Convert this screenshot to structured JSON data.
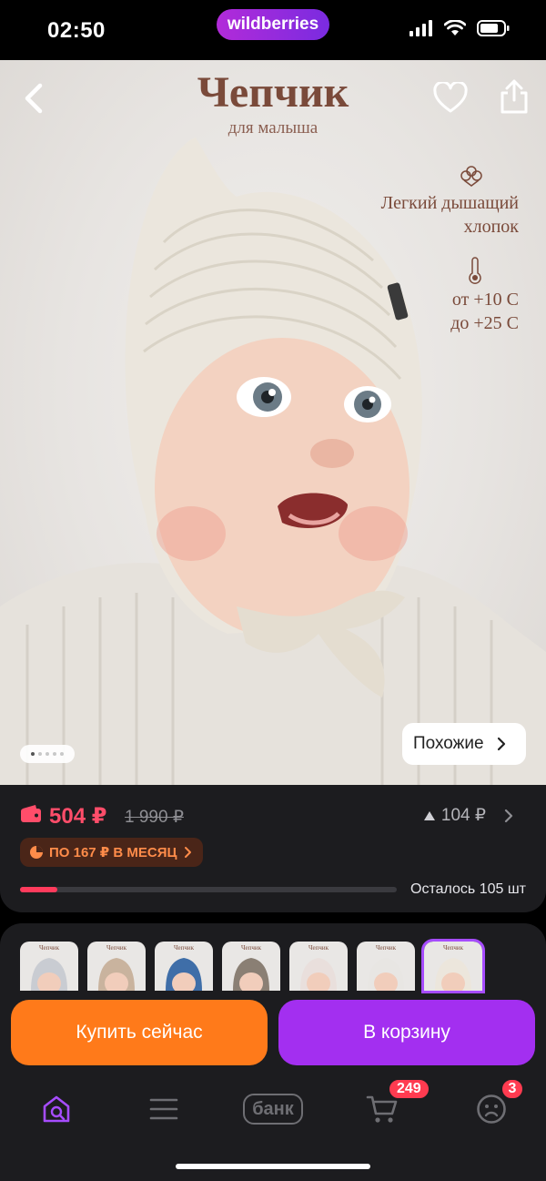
{
  "status_bar": {
    "time": "02:50",
    "app_pill": "wildberries"
  },
  "hero": {
    "title": "Чепчик",
    "subtitle": "для малыша",
    "feature1": [
      "Легкий дышащий",
      "хлопок"
    ],
    "feature2": [
      "от +10 С",
      "до +25 С"
    ],
    "similar_label": "Похожие",
    "carousel_dots": 5,
    "carousel_index": 0
  },
  "price": {
    "current": "504 ₽",
    "old": "1 990 ₽",
    "delta": "104 ₽",
    "installment": "ПО 167 ₽ В МЕСЯЦ",
    "stock_label": "Осталось 105 шт",
    "stock_fraction": 0.1
  },
  "variants": {
    "thumb_label": "Чепчик",
    "colors": [
      "#c9ccd2",
      "#c9b39e",
      "#3f6ea8",
      "#8a7f74",
      "#e9dfdc",
      "#e8e6e3",
      "#ece6dc"
    ],
    "selected_index": 6
  },
  "actions": {
    "buy_now": "Купить сейчас",
    "add_to_cart": "В корзину"
  },
  "nav": {
    "bank_label": "банк",
    "cart_badge": "249",
    "profile_badge": "3"
  },
  "colors": {
    "accent_purple": "#a32ff0",
    "accent_orange": "#ff7a1a",
    "price_red": "#ff4d6a"
  }
}
